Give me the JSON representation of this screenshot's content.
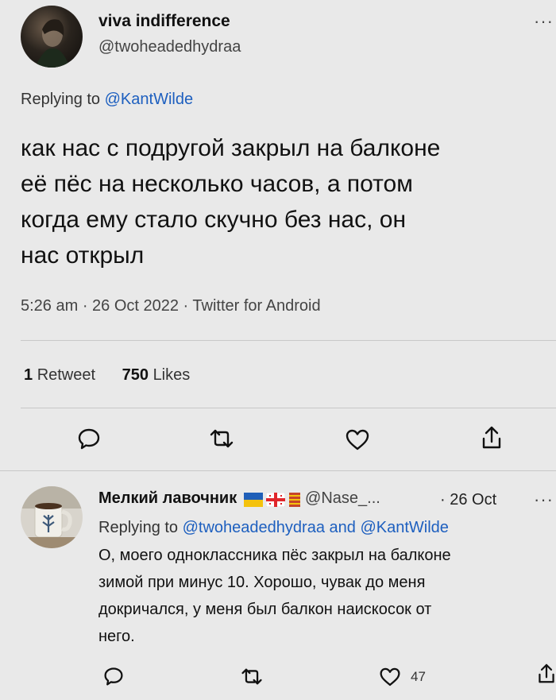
{
  "tweet": {
    "display_name": "viva indifference",
    "handle": "@twoheadedhydraa",
    "more": "···",
    "replying_prefix": "Replying to",
    "replying_to": "@KantWilde",
    "text_lines": [
      "как нас с подругой закрыл на балконе",
      "её пёс на несколько часов, а потом",
      "когда ему стало скучно без нас, он",
      "нас открыл"
    ],
    "timestamp": "5:26 am · 26 Oct 2022 · Twitter for Android",
    "retweets_count": "1",
    "retweets_label": "Retweet",
    "likes_count": "750",
    "likes_label": "Likes",
    "actions": [
      "reply-icon",
      "retweet-icon",
      "heart-icon",
      "share-icon"
    ]
  },
  "reply": {
    "display_name": "Мелкий лавочник",
    "handle": "@Nase_...",
    "date": "· 26 Oct",
    "more": "···",
    "replying_prefix": "Replying to",
    "replying_to_1": "@twoheadedhydraa",
    "and": "and",
    "replying_to_2": "@KantWilde",
    "text_lines": [
      "О, моего одноклассника пёс закрыл на балконе",
      "зимой при минус 10. Хорошо, чувак до меня",
      "докричался, у меня был балкон наискосок от",
      "него."
    ],
    "like_count": "47",
    "flags": [
      "flag-ukraine",
      "flag-georgia",
      "flag-catalonia"
    ]
  },
  "colors": {
    "background": "#e9e9e9",
    "link": "#1d5fbf",
    "text": "#111111",
    "muted": "#444444"
  }
}
